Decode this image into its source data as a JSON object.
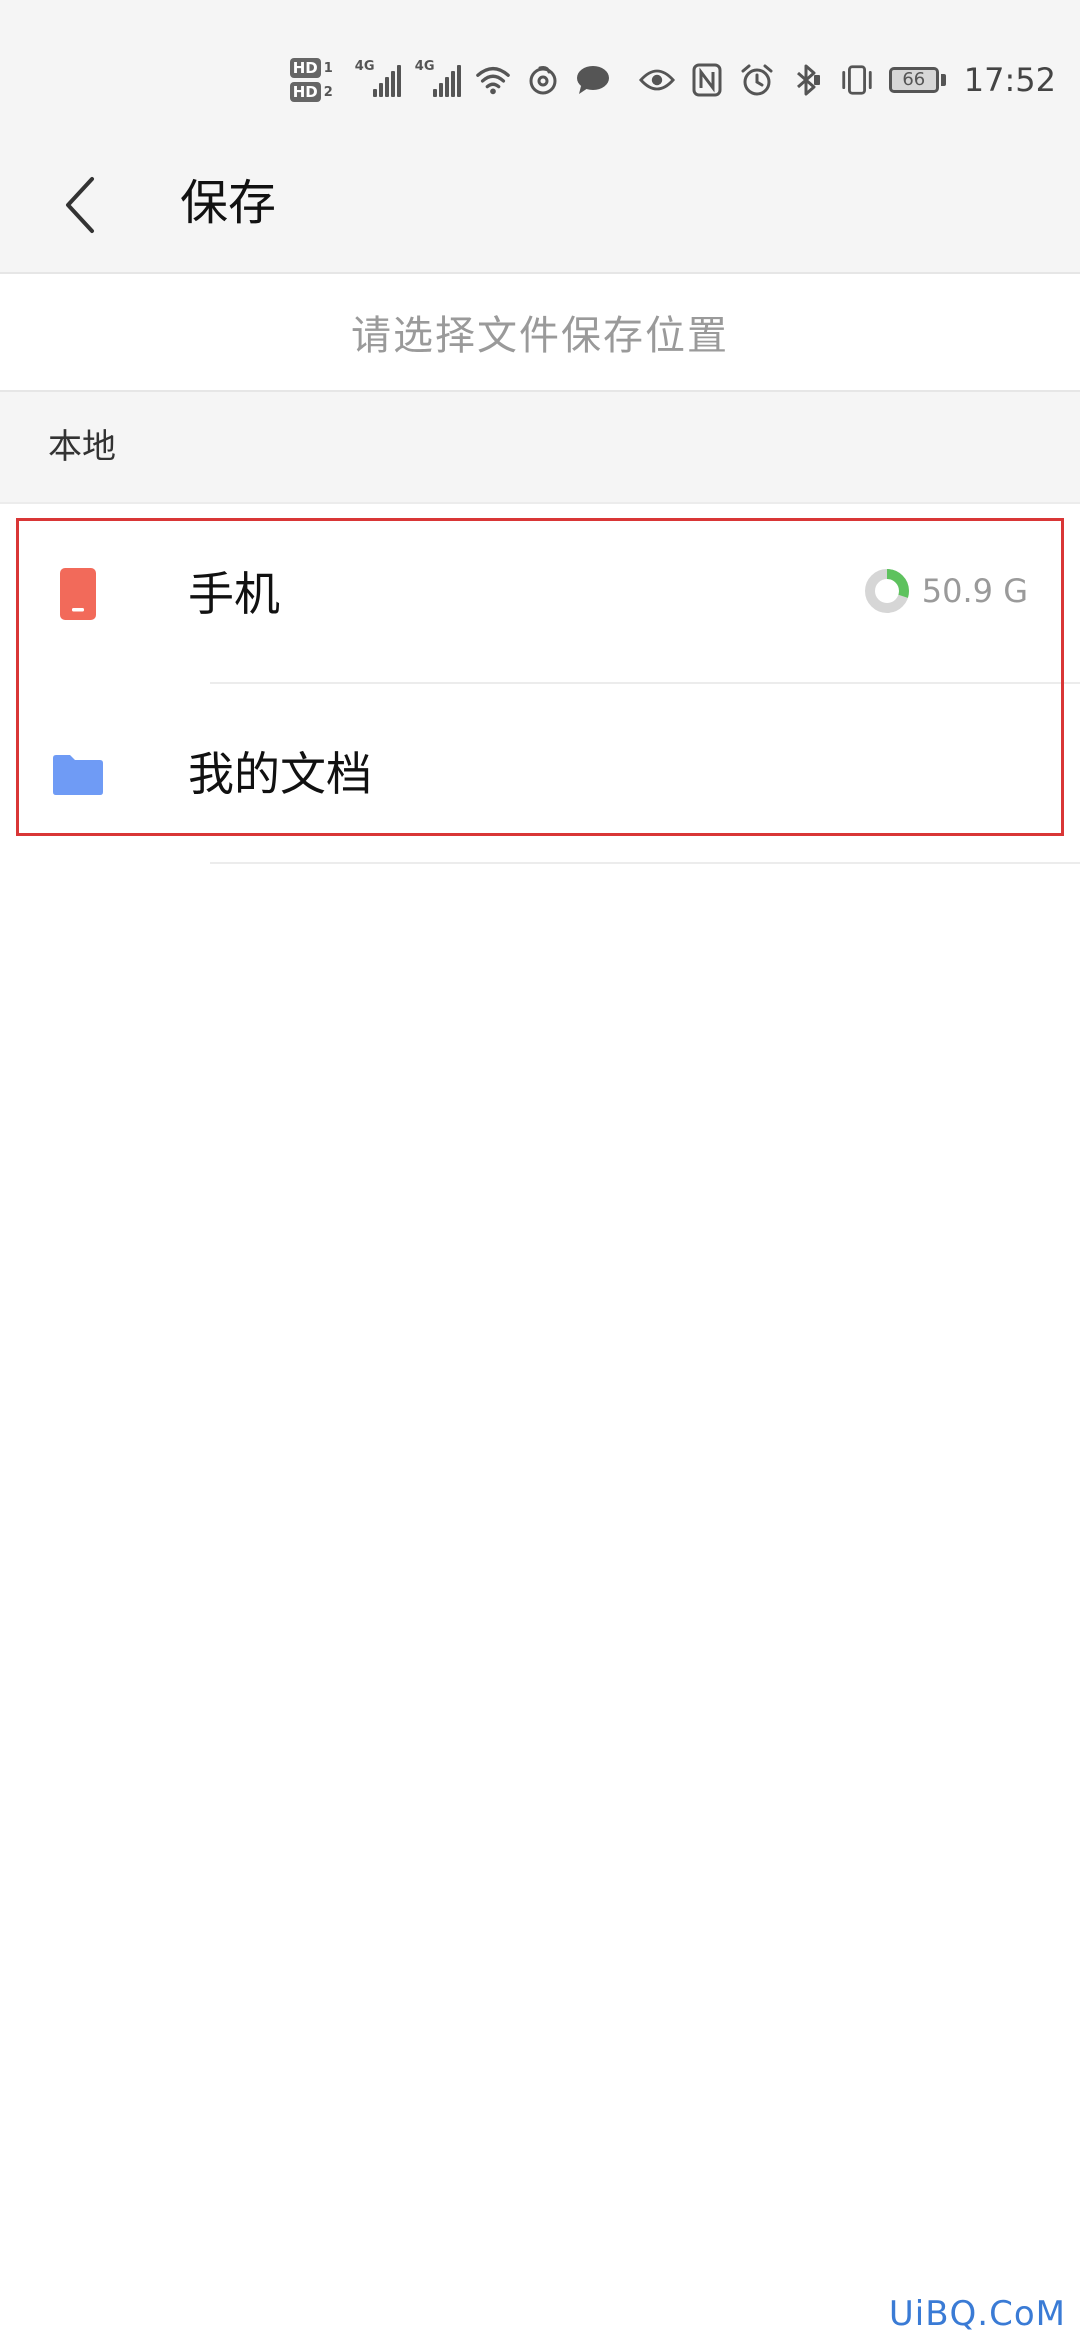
{
  "status_bar": {
    "hd_labels": [
      "HD",
      "HD"
    ],
    "sim_numbers": [
      "1",
      "2"
    ],
    "network_labels": [
      "4G",
      "4G"
    ],
    "battery_level": "66",
    "time": "17:52",
    "icons": [
      "hd-icon",
      "signal-icon",
      "wifi-icon",
      "netease-music-icon",
      "chat-bubble-icon",
      "eye-icon",
      "nfc-icon",
      "alarm-icon",
      "bluetooth-icon",
      "vibrate-icon",
      "battery-icon"
    ]
  },
  "header": {
    "back_icon": "chevron-left-icon",
    "title": "保存"
  },
  "hint": {
    "text": "请选择文件保存位置"
  },
  "section": {
    "title": "本地"
  },
  "list": {
    "items": [
      {
        "label": "手机",
        "icon": "phone-icon",
        "storage": "50.9 G",
        "storage_used_fraction": 0.3
      },
      {
        "label": "我的文档",
        "icon": "folder-icon"
      }
    ]
  },
  "colors": {
    "phone_icon": "#f26a5a",
    "folder_icon": "#6f9bf5",
    "storage_ring_used": "#5ec25e",
    "storage_ring_free": "#d6d6d6",
    "highlight": "#d93636",
    "watermark": "#3a7bd5"
  },
  "watermark": {
    "text": "UiBQ.CoM"
  }
}
